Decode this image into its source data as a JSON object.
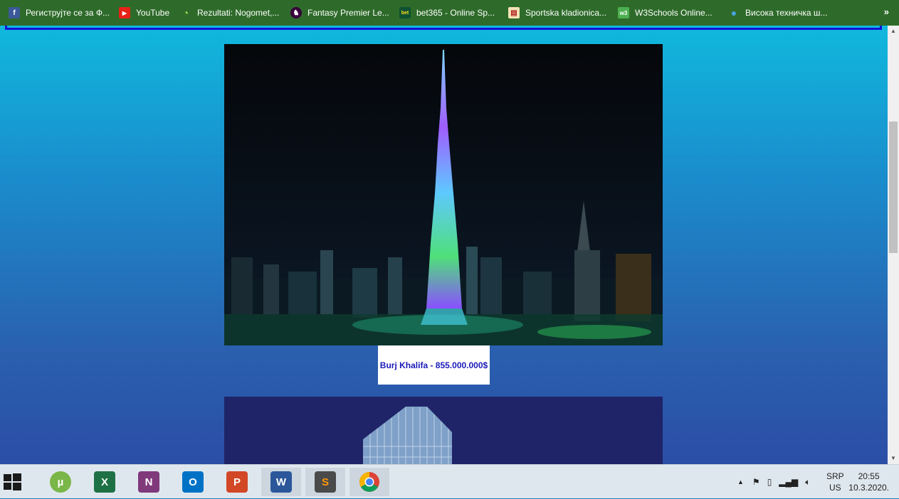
{
  "bookmarks": [
    {
      "label": "Региструјте се за Ф...",
      "icon": "facebook-icon",
      "color": "#3b5998",
      "glyph": "f"
    },
    {
      "label": "YouTube",
      "icon": "youtube-icon",
      "color": "#e62117",
      "glyph": "▶"
    },
    {
      "label": "Rezultati: Nogomet,...",
      "icon": "rezultati-icon",
      "color": "#2e6b2a",
      "glyph": "◔"
    },
    {
      "label": "Fantasy Premier Le...",
      "icon": "premier-league-icon",
      "color": "#38003c",
      "glyph": "♞"
    },
    {
      "label": "bet365 - Online Sp...",
      "icon": "bet365-icon",
      "color": "#0f5132",
      "glyph": "bet"
    },
    {
      "label": "Sportska kladionica...",
      "icon": "kladionica-icon",
      "color": "#f4e3b5",
      "glyph": "▤"
    },
    {
      "label": "W3Schools Online...",
      "icon": "w3schools-icon",
      "color": "#4caf50",
      "glyph": "w3"
    },
    {
      "label": "Висока техничка ш...",
      "icon": "school-icon",
      "color": "#1a73b8",
      "glyph": "●"
    }
  ],
  "bookmarks_more": "»",
  "caption": "Burj Khalifa - 855.000.000$",
  "taskbar": {
    "apps": [
      {
        "name": "utorrent",
        "icon": "utorrent-icon",
        "color": "#7ab648",
        "glyph": "µ"
      },
      {
        "name": "excel",
        "icon": "excel-icon",
        "color": "#1e7145",
        "glyph": "X"
      },
      {
        "name": "onenote",
        "icon": "onenote-icon",
        "color": "#80397b",
        "glyph": "N"
      },
      {
        "name": "outlook",
        "icon": "outlook-icon",
        "color": "#0072c6",
        "glyph": "O"
      },
      {
        "name": "powerpoint",
        "icon": "powerpoint-icon",
        "color": "#d24726",
        "glyph": "P"
      },
      {
        "name": "word",
        "icon": "word-icon",
        "color": "#2b579a",
        "glyph": "W"
      },
      {
        "name": "sublime",
        "icon": "sublime-text-icon",
        "color": "#4a4a4a",
        "glyph": "S"
      },
      {
        "name": "chrome",
        "icon": "chrome-icon",
        "color": "#db4437",
        "glyph": "◉"
      }
    ],
    "lang_top": "SRP",
    "lang_bottom": "US",
    "time": "20:55",
    "date": "10.3.2020."
  }
}
